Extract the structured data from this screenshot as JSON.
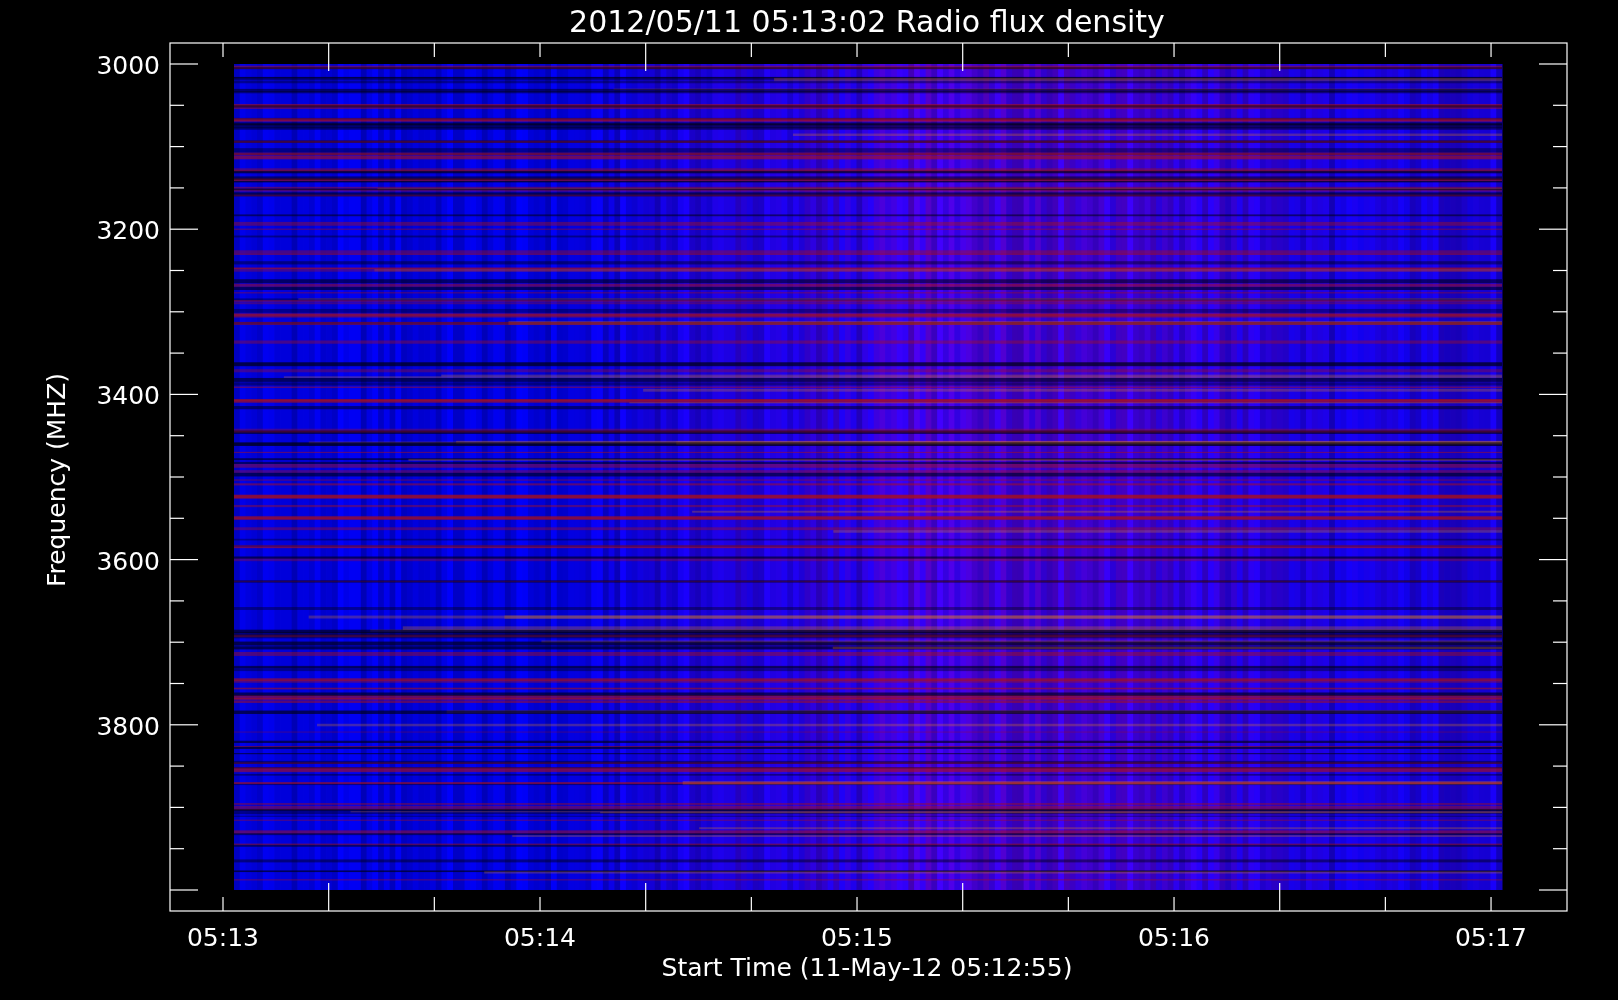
{
  "title": "2012/05/11 05:13:02 Radio flux density",
  "y_axis": {
    "label": "Frequency (MHZ)",
    "ticks": [
      "3000",
      "3200",
      "3400",
      "3600",
      "3800"
    ]
  },
  "x_axis": {
    "label": "Start Time (11-May-12 05:12:55)",
    "ticks": [
      "05:13",
      "05:14",
      "05:15",
      "05:16",
      "05:17"
    ]
  }
}
